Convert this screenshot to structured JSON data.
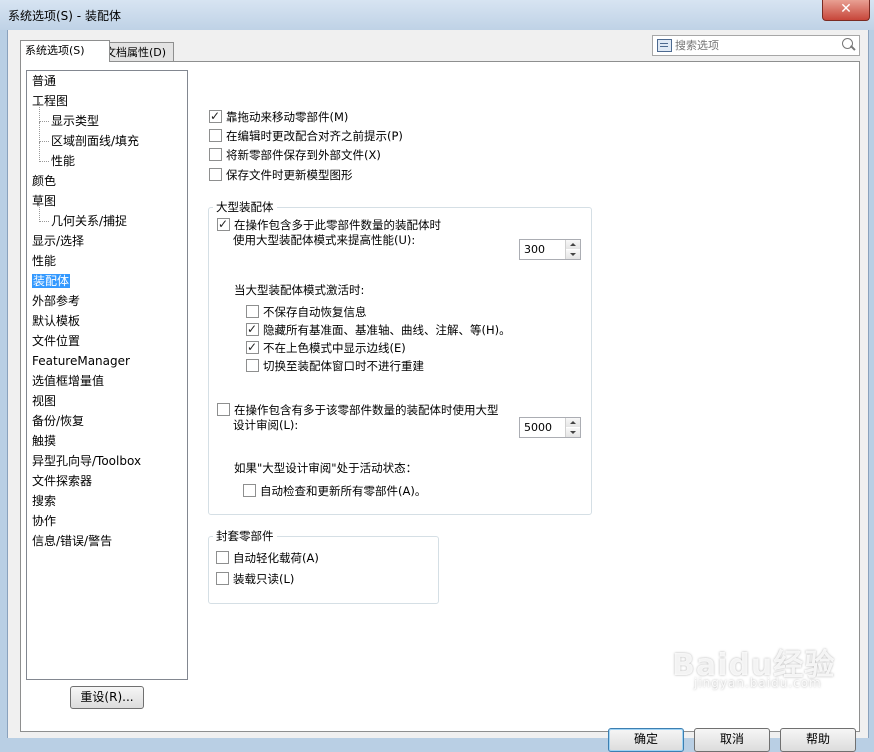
{
  "window": {
    "title": "系统选项(S) - 装配体",
    "close_glyph": "✕"
  },
  "tabs": [
    {
      "label": "系统选项(S)",
      "active": true
    },
    {
      "label": "文档属性(D)",
      "active": false
    }
  ],
  "search": {
    "placeholder": "搜索选项"
  },
  "tree": {
    "items": [
      {
        "label": "普通"
      },
      {
        "label": "工程图"
      },
      {
        "label": "显示类型"
      },
      {
        "label": "区域剖面线/填充"
      },
      {
        "label": "性能"
      },
      {
        "label": "颜色"
      },
      {
        "label": "草图"
      },
      {
        "label": "几何关系/捕捉"
      },
      {
        "label": "显示/选择"
      },
      {
        "label": "性能"
      },
      {
        "label": "装配体"
      },
      {
        "label": "外部参考"
      },
      {
        "label": "默认模板"
      },
      {
        "label": "文件位置"
      },
      {
        "label": "FeatureManager"
      },
      {
        "label": "选值框增量值"
      },
      {
        "label": "视图"
      },
      {
        "label": "备份/恢复"
      },
      {
        "label": "触摸"
      },
      {
        "label": "异型孔向导/Toolbox"
      },
      {
        "label": "文件探索器"
      },
      {
        "label": "搜索"
      },
      {
        "label": "协作"
      },
      {
        "label": "信息/错误/警告"
      }
    ],
    "selected": "装配体"
  },
  "reset_button": "重设(R)...",
  "options": {
    "drag_move": {
      "label": "靠拖动来移动零部件(M)",
      "checked": true
    },
    "prompt_align": {
      "label": "在编辑时更改配合对齐之前提示(P)",
      "checked": false
    },
    "save_external": {
      "label": "将新零部件保存到外部文件(X)",
      "checked": false
    },
    "update_graphics": {
      "label": "保存文件时更新模型图形",
      "checked": false
    }
  },
  "large_assembly": {
    "group_label": "大型装配体",
    "use_mode": {
      "label_line1": "在操作包含多于此零部件数量的装配体时",
      "label_line2": "使用大型装配体模式来提高性能(U):",
      "checked": true,
      "value": "300"
    },
    "when_active_label": "当大型装配体模式激活时:",
    "no_autorecover": {
      "label": "不保存自动恢复信息",
      "checked": false
    },
    "hide_planes": {
      "label": "隐藏所有基准面、基准轴、曲线、注解、等(H)。",
      "checked": true
    },
    "no_edges": {
      "label": "不在上色模式中显示边线(E)",
      "checked": true
    },
    "no_rebuild": {
      "label": "切换至装配体窗口时不进行重建",
      "checked": false
    },
    "use_review": {
      "label_line1": "在操作包含有多于该零部件数量的装配体时使用大型",
      "label_line2": "设计审阅(L):",
      "checked": false,
      "value": "5000"
    },
    "review_active_label": "如果\"大型设计审阅\"处于活动状态：",
    "auto_check": {
      "label": "自动检查和更新所有零部件(A)。",
      "checked": false
    }
  },
  "envelope": {
    "group_label": "封套零部件",
    "auto_lightweight": {
      "label": "自动轻化载荷(A)",
      "checked": false
    },
    "load_readonly": {
      "label": "装载只读(L)",
      "checked": false
    }
  },
  "dialog_buttons": {
    "ok": "确定",
    "cancel": "取消",
    "help": "帮助"
  },
  "watermark": {
    "logo": "Baidu经验",
    "url": "jingyan.baidu.com"
  }
}
